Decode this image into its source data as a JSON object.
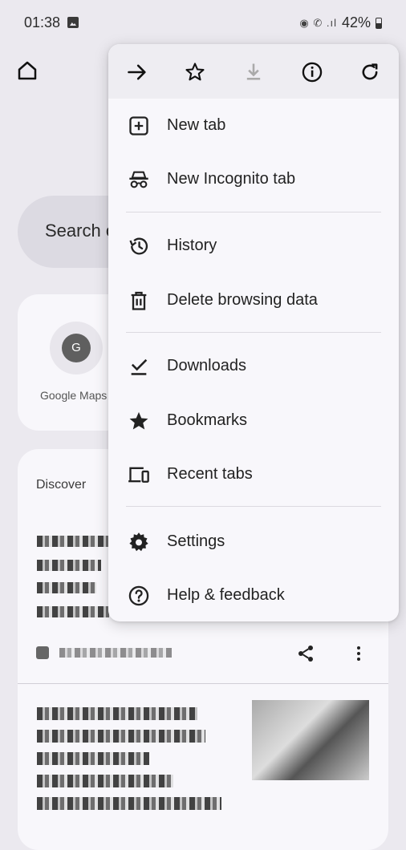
{
  "status_bar": {
    "time": "01:38",
    "icons": "◉ ✆ .ıl",
    "battery": "42%"
  },
  "new_tab_page": {
    "search_placeholder": "Search o",
    "shortcut": {
      "letter": "G",
      "label": "Google Maps"
    },
    "discover_title": "Discover"
  },
  "menu": {
    "toolbar": [
      "forward-icon",
      "bookmark-star-icon",
      "download-icon",
      "info-icon",
      "reload-icon"
    ],
    "items": [
      {
        "label": "New tab",
        "icon": "new-tab-icon"
      },
      {
        "label": "New Incognito tab",
        "icon": "incognito-icon"
      },
      {
        "label": "History",
        "icon": "history-icon"
      },
      {
        "label": "Delete browsing data",
        "icon": "delete-icon"
      },
      {
        "label": "Downloads",
        "icon": "downloads-check-icon"
      },
      {
        "label": "Bookmarks",
        "icon": "star-icon"
      },
      {
        "label": "Recent tabs",
        "icon": "devices-icon"
      },
      {
        "label": "Settings",
        "icon": "gear-icon"
      },
      {
        "label": "Help & feedback",
        "icon": "help-icon"
      }
    ]
  },
  "colors": {
    "background": "#ebe9ef",
    "menu_bg": "#f8f7fb",
    "toolbar_bg": "#eeedf2",
    "icon": "#1f1f1f"
  }
}
